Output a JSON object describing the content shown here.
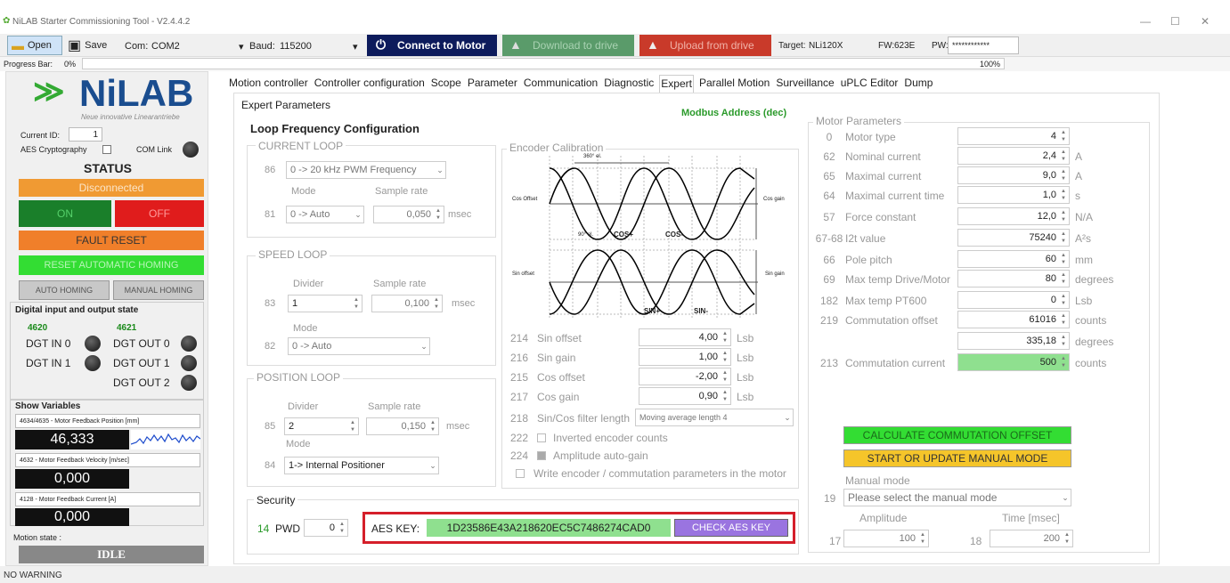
{
  "window": {
    "title": "NiLAB Starter Commissioning Tool - V2.4.4.2"
  },
  "toolbar": {
    "open": "Open",
    "save": "Save",
    "com_label": "Com:",
    "com_value": "COM2",
    "baud_label": "Baud:",
    "baud_value": "115200",
    "connect": "Connect to Motor",
    "download": "Download to drive",
    "upload": "Upload from drive",
    "target_label": "Target:",
    "target_value": "NLi120X",
    "fw_label": "FW:",
    "fw_value": "623E",
    "pw_label": "PW:",
    "pw_value": "************"
  },
  "progress": {
    "label": "Progress Bar:",
    "start": "0%",
    "end": "100%"
  },
  "left": {
    "logo": "NiLAB",
    "logo_sub": "Neue innovative Linearantriebe",
    "current_id_label": "Current ID:",
    "current_id": "1",
    "aes_crypto": "AES Cryptography",
    "com_link": "COM Link",
    "status_title": "STATUS",
    "disconnected": "Disconnected",
    "on": "ON",
    "off": "OFF",
    "fault_reset": "FAULT RESET",
    "reset_homing": "RESET AUTOMATIC HOMING",
    "auto_homing": "AUTO HOMING",
    "manual_homing": "MANUAL HOMING",
    "dio_title": "Digital input and output state",
    "dio_a": "4620",
    "dio_b": "4621",
    "dgt_in0": "DGT IN 0",
    "dgt_in1": "DGT IN 1",
    "dgt_out0": "DGT OUT 0",
    "dgt_out1": "DGT OUT 1",
    "dgt_out2": "DGT OUT 2",
    "show_vars": "Show Variables",
    "var1": "4634/4635 - Motor Feedback Position [mm]",
    "val1": "46,333",
    "var2": "4632 - Motor Feedback Velocity [m/sec]",
    "val2": "0,000",
    "var3": "4128 - Motor Feedback Current [A]",
    "val3": "0,000",
    "motion_state": "Motion state :",
    "idle": "IDLE"
  },
  "tabs": [
    "Motion controller",
    "Controller configuration",
    "Scope",
    "Parameter",
    "Communication",
    "Diagnostic",
    "Expert",
    "Parallel Motion",
    "Surveillance",
    "uPLC Editor",
    "Dump"
  ],
  "expert": {
    "title": "Expert Parameters",
    "modbus": "Modbus Address (dec)",
    "loop_title": "Loop Frequency Configuration",
    "current_loop": "CURRENT LOOP",
    "cl_num": "86",
    "cl_value": "0 -> 20 kHz PWM Frequency",
    "mode": "Mode",
    "sample_rate": "Sample rate",
    "cl_mode_num": "81",
    "cl_mode": "0 -> Auto",
    "cl_rate": "0,050",
    "msec": "msec",
    "speed_loop": "SPEED LOOP",
    "divider": "Divider",
    "sl_num": "83",
    "sl_div": "1",
    "sl_rate": "0,100",
    "sl_mode_num": "82",
    "sl_mode": "0 -> Auto",
    "pos_loop": "POSITION LOOP",
    "pl_num": "85",
    "pl_div": "2",
    "pl_rate": "0,150",
    "pl_mode_num": "84",
    "pl_mode": "1-> Internal Positioner",
    "enc_title": "Encoder Calibration",
    "enc_360": "360° el.",
    "enc_cos_offset": "Cos Offset",
    "enc_cos_gain": "Cos gain",
    "enc_sin_offset": "Sin offset",
    "enc_sin_gain": "Sin gain",
    "enc_90": "90° el.",
    "enc_cosp": "COS+",
    "enc_cosm": "COS-",
    "enc_sinp": "SIN+",
    "enc_sinm": "SIN-",
    "p214": "214",
    "sin_offset": "Sin offset",
    "v214": "4,00",
    "p216": "216",
    "sin_gain": "Sin gain",
    "v216": "1,00",
    "p215": "215",
    "cos_offset": "Cos offset",
    "v215": "-2,00",
    "p217": "217",
    "cos_gain": "Cos gain",
    "v217": "0,90",
    "lsb": "Lsb",
    "p218": "218",
    "filter_label": "Sin/Cos filter length",
    "filter_value": "Moving average length 4",
    "p222": "222",
    "inverted": "Inverted encoder counts",
    "p224": "224",
    "autogain": "Amplitude auto-gain",
    "write_enc": "Write encoder / commutation parameters in the motor",
    "security": "Security",
    "p14": "14",
    "pwd": "PWD",
    "pwd_value": "0",
    "aes_key_label": "AES KEY:",
    "aes_key": "1D23586E43A218620EC5C7486274CAD0",
    "check_aes": "CHECK AES KEY",
    "motor_params": "Motor Parameters",
    "mp": [
      {
        "n": "0",
        "l": "Motor type",
        "v": "4",
        "u": ""
      },
      {
        "n": "62",
        "l": "Nominal current",
        "v": "2,4",
        "u": "A"
      },
      {
        "n": "65",
        "l": "Maximal current",
        "v": "9,0",
        "u": "A"
      },
      {
        "n": "64",
        "l": "Maximal current time",
        "v": "1,0",
        "u": "s"
      },
      {
        "n": "57",
        "l": "Force constant",
        "v": "12,0",
        "u": "N/A"
      },
      {
        "n": "67-68",
        "l": "I2t value",
        "v": "75240",
        "u": "A²s"
      },
      {
        "n": "66",
        "l": "Pole pitch",
        "v": "60",
        "u": "mm"
      },
      {
        "n": "69",
        "l": "Max temp Drive/Motor",
        "v": "80",
        "u": "degrees"
      },
      {
        "n": "182",
        "l": "Max temp PT600",
        "v": "0",
        "u": "Lsb"
      },
      {
        "n": "219",
        "l": "Commutation offset",
        "v": "61016",
        "u": "counts"
      },
      {
        "n": "",
        "l": "",
        "v": "335,18",
        "u": "degrees"
      },
      {
        "n": "213",
        "l": "Commutation current",
        "v": "500",
        "u": "counts"
      }
    ],
    "calc_comm": "CALCULATE COMMUTATION OFFSET",
    "start_manual": "START OR UPDATE MANUAL MODE",
    "manual_mode": "Manual mode",
    "p19": "19",
    "manual_select": "Please select the manual mode",
    "amplitude": "Amplitude",
    "time": "Time [msec]",
    "p17": "17",
    "amp_value": "100",
    "p18": "18",
    "time_value": "200"
  },
  "status_bar": "NO WARNING"
}
